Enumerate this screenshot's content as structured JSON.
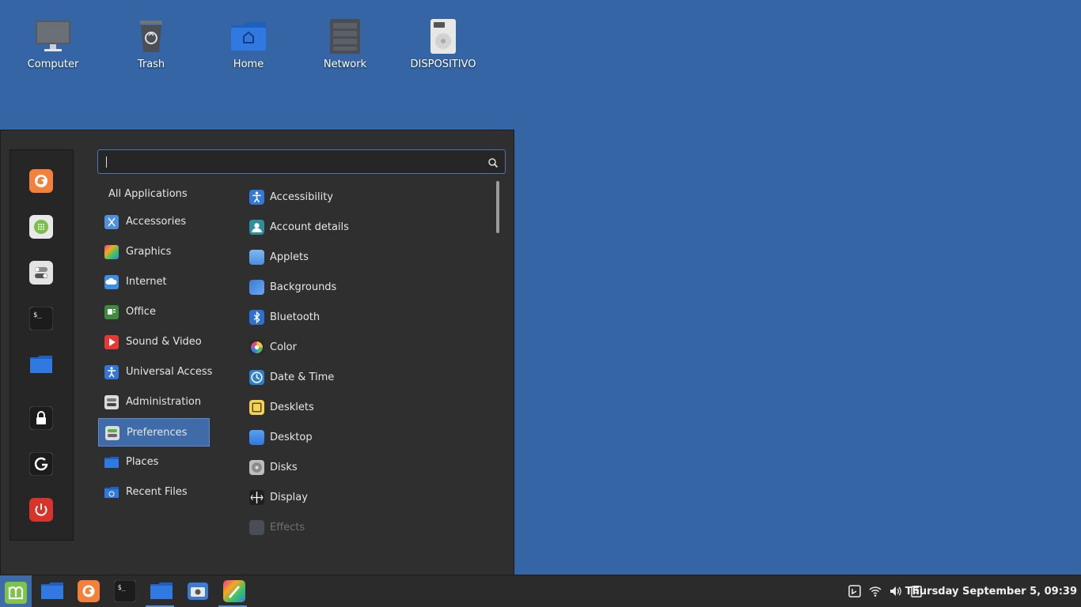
{
  "desktop": {
    "icons": [
      {
        "label": "Computer"
      },
      {
        "label": "Trash"
      },
      {
        "label": "Home"
      },
      {
        "label": "Network"
      },
      {
        "label": "DISPOSITIVO"
      }
    ]
  },
  "menu": {
    "search": {
      "value": "",
      "placeholder": ""
    },
    "favorites": [
      "firefox-icon",
      "software-manager-icon",
      "system-settings-icon",
      "terminal-icon",
      "files-icon",
      "lock-screen-icon",
      "logout-icon",
      "power-icon"
    ],
    "categories": [
      {
        "label": "All Applications"
      },
      {
        "label": "Accessories"
      },
      {
        "label": "Graphics"
      },
      {
        "label": "Internet"
      },
      {
        "label": "Office"
      },
      {
        "label": "Sound & Video"
      },
      {
        "label": "Universal Access"
      },
      {
        "label": "Administration"
      },
      {
        "label": "Preferences"
      },
      {
        "label": "Places"
      },
      {
        "label": "Recent Files"
      }
    ],
    "selected_category": "Preferences",
    "apps": [
      {
        "label": "Accessibility"
      },
      {
        "label": "Account details"
      },
      {
        "label": "Applets"
      },
      {
        "label": "Backgrounds"
      },
      {
        "label": "Bluetooth"
      },
      {
        "label": "Color"
      },
      {
        "label": "Date & Time"
      },
      {
        "label": "Desklets"
      },
      {
        "label": "Desktop"
      },
      {
        "label": "Disks"
      },
      {
        "label": "Display"
      },
      {
        "label": "Effects"
      }
    ]
  },
  "panel": {
    "clock": "Thursday September  5, 09:39",
    "launchers": [
      "mint-menu-icon",
      "files-icon",
      "firefox-icon",
      "terminal-icon",
      "folder-icon",
      "screenshot-icon",
      "drawing-icon"
    ]
  },
  "colors": {
    "desktop_bg": "#3565a5",
    "menu_bg": "#2f2f2f",
    "accent": "#3f6ca8",
    "panel_bg": "#2b2b2b"
  }
}
